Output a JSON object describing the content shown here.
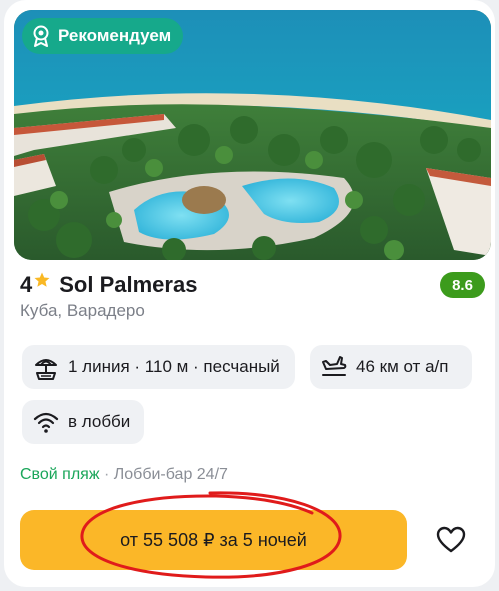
{
  "badge": {
    "label": "Рекомендуем",
    "icon": "award-ribbon-icon",
    "color": "#16a98b"
  },
  "hotel": {
    "stars": "4",
    "star_icon": "star-icon",
    "name": "Sol Palmeras",
    "rating": "8.6",
    "rating_color": "#3c9b1c",
    "location": "Куба, Варадеро"
  },
  "features": {
    "beach": {
      "icon": "beach-umbrella-icon",
      "label": "1 линия · 110 м · песчаный"
    },
    "airport": {
      "icon": "plane-landing-icon",
      "label": "46 км от а/п"
    },
    "wifi": {
      "icon": "wifi-icon",
      "label": "в лобби"
    }
  },
  "amenities": {
    "highlight": "Свой пляж",
    "separator": " · ",
    "rest": "Лобби-бар 24/7"
  },
  "price": {
    "label": "от 55 508 ₽ за 5 ночей",
    "button_color": "#fbb728"
  },
  "favorite": {
    "icon": "heart-icon"
  },
  "annotation": {
    "color": "#e01b1b"
  }
}
